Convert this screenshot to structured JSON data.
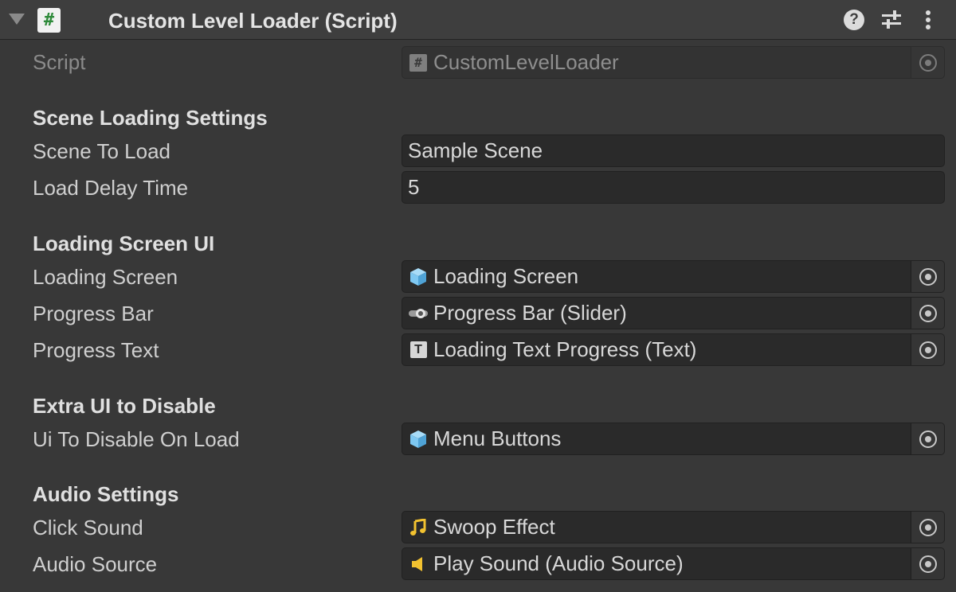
{
  "header": {
    "title": "Custom Level Loader (Script)",
    "icon": "csharp-script-icon",
    "actions": [
      "help-icon",
      "presets-icon",
      "kebab-menu-icon"
    ]
  },
  "fields": {
    "script": {
      "label": "Script",
      "value": "CustomLevelLoader",
      "icon": "script-icon"
    },
    "scene_to_load": {
      "label": "Scene To Load",
      "value": "Sample Scene"
    },
    "load_delay_time": {
      "label": "Load Delay Time",
      "value": "5"
    },
    "loading_screen": {
      "label": "Loading Screen",
      "value": "Loading Screen",
      "icon": "gameobject-cube-icon"
    },
    "progress_bar": {
      "label": "Progress Bar",
      "value": "Progress Bar (Slider)",
      "icon": "slider-icon"
    },
    "progress_text": {
      "label": "Progress Text",
      "value": "Loading Text Progress (Text)",
      "icon": "text-icon"
    },
    "ui_to_disable": {
      "label": "Ui To Disable On Load",
      "value": "Menu Buttons",
      "icon": "gameobject-cube-icon"
    },
    "click_sound": {
      "label": "Click Sound",
      "value": "Swoop Effect",
      "icon": "audio-clip-icon"
    },
    "audio_source": {
      "label": "Audio Source",
      "value": "Play Sound (Audio Source)",
      "icon": "audio-source-icon"
    }
  },
  "sections": {
    "scene_loading": "Scene Loading Settings",
    "loading_screen_ui": "Loading Screen UI",
    "extra_ui": "Extra UI to Disable",
    "audio": "Audio Settings"
  },
  "colors": {
    "background": "#383838",
    "field_background": "#2a2a2a",
    "cube_icon": "#7ec8f2",
    "audio_icon": "#f2c230"
  }
}
